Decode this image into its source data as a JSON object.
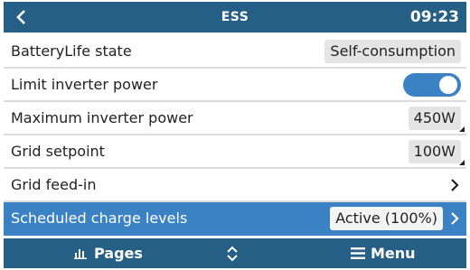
{
  "header": {
    "title": "ESS",
    "clock": "09:23",
    "back_icon": "chevron-left-icon"
  },
  "rows": [
    {
      "label": "BatteryLife state",
      "value": "Self-consumption"
    },
    {
      "label": "Limit inverter power",
      "toggle_on": true
    },
    {
      "label": "Maximum inverter power",
      "value": "450W"
    },
    {
      "label": "Grid setpoint",
      "value": "100W"
    },
    {
      "label": "Grid feed-in",
      "icon": "chevron-right-icon"
    },
    {
      "label": "Scheduled charge levels",
      "value": "Active (100%)",
      "icon": "chevron-right-icon",
      "selected": true
    }
  ],
  "footer": {
    "pages_label": "Pages",
    "pages_icon": "bar-chart-icon",
    "scroll_icon": "up-down-chevron-icon",
    "menu_label": "Menu",
    "menu_icon": "hamburger-icon"
  },
  "colors": {
    "bar": "#255f86",
    "accent": "#3b82c4",
    "divider": "#dcdcdc",
    "value_bg": "#e4e4e4"
  }
}
